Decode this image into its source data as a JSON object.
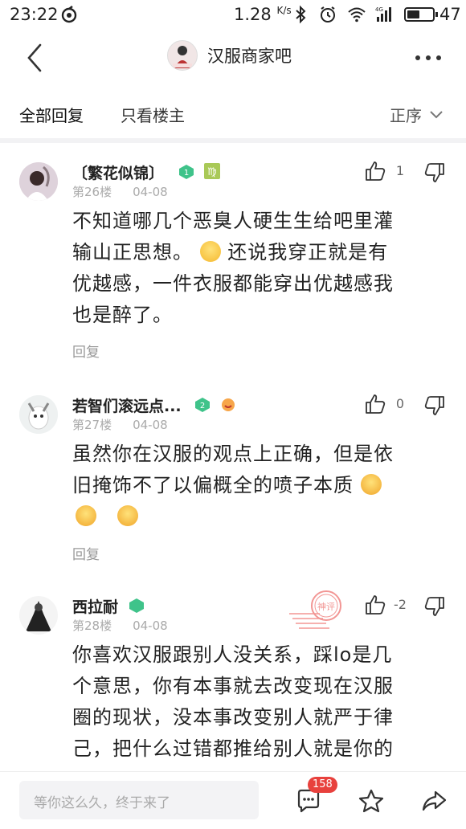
{
  "status_bar": {
    "time": "23:22",
    "speed": "1.28",
    "speed_unit": "K/s",
    "network": "4G",
    "battery_pct": "47"
  },
  "header": {
    "title": "汉服商家吧",
    "back_icon": "chevron-left-icon",
    "more_icon": "more-dots-icon"
  },
  "tabs": {
    "all_replies": "全部回复",
    "owner_only": "只看楼主",
    "sort": "正序"
  },
  "posts": [
    {
      "username": "〔繁花似锦〕",
      "level": "1",
      "floor": "第26楼",
      "date": "04-08",
      "likes": "1",
      "body_lines": [
        "不知道哪几个恶臭人硬生生给吧里灌",
        "输山正思想。",
        "还说我穿正就是有",
        "优越感，一件衣服都能穿出优越感我",
        "也是醉了。"
      ],
      "reply": "回复"
    },
    {
      "username": "若智们滚远点...",
      "level": "2",
      "floor": "第27楼",
      "date": "04-08",
      "likes": "0",
      "body_lines": [
        "虽然你在汉服的观点上正确，但是依",
        "旧掩饰不了以偏概全的喷子本质"
      ],
      "reply": "回复"
    },
    {
      "username": "西拉耐",
      "level": "",
      "floor": "第28楼",
      "date": "04-08",
      "likes": "-2",
      "body_lines": [
        "你喜欢汉服跟别人没关系，踩lo是几",
        "个意思，你有本事就去改变现在汉服",
        "圈的现状，没本事改变别人就严于律",
        "己，把什么过错都推给别人就是你的"
      ],
      "stamp": "神评"
    }
  ],
  "bottom_bar": {
    "placeholder": "等你这么久，终于来了",
    "comment_count": "158"
  },
  "colors": {
    "accent_red": "#e8413d",
    "badge_green": "#3fc38a",
    "text_gray": "#aaaaaa"
  }
}
